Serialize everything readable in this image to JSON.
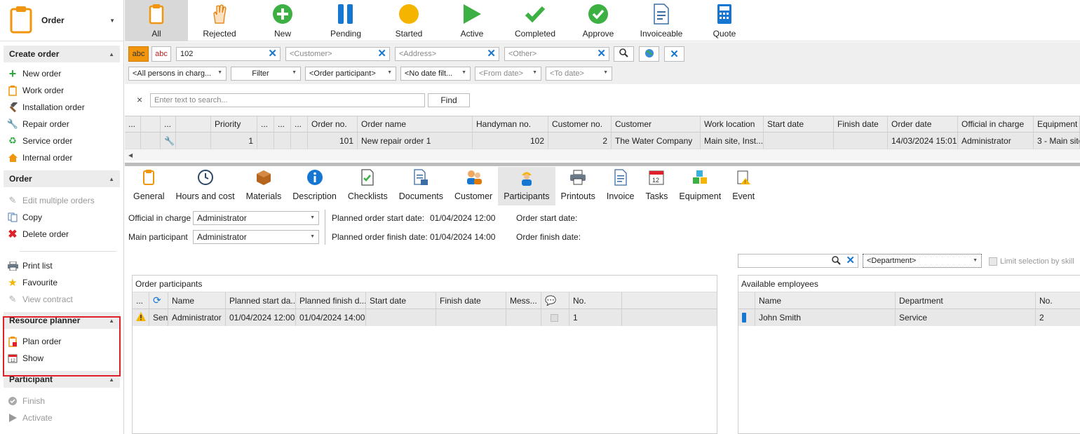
{
  "app": {
    "module_title": "Order"
  },
  "colors": {
    "accent_blue": "#1677d2",
    "orange": "#f0950c",
    "green": "#2eaa3f",
    "red": "#e0202a",
    "highlight_box": "#e0202a"
  },
  "toolbar": [
    {
      "label": "All",
      "icon": "clipboard-icon",
      "active": true
    },
    {
      "label": "Rejected",
      "icon": "hand-icon"
    },
    {
      "label": "New",
      "icon": "plus-icon"
    },
    {
      "label": "Pending",
      "icon": "pause-icon"
    },
    {
      "label": "Started",
      "icon": "circle-icon"
    },
    {
      "label": "Active",
      "icon": "play-icon"
    },
    {
      "label": "Completed",
      "icon": "check-icon"
    },
    {
      "label": "Approve",
      "icon": "approve-icon"
    },
    {
      "label": "Invoiceable",
      "icon": "invoice-icon"
    },
    {
      "label": "Quote",
      "icon": "calculator-icon"
    }
  ],
  "sidebar": {
    "sections": {
      "create_order": {
        "title": "Create order",
        "items": [
          "New order",
          "Work order",
          "Installation order",
          "Repair order",
          "Service order",
          "Internal order"
        ]
      },
      "order": {
        "title": "Order",
        "items": [
          "Edit multiple orders",
          "Copy",
          "Delete order",
          "Print list",
          "Favourite",
          "View contract"
        ]
      },
      "resource_planner": {
        "title": "Resource planner",
        "items": [
          "Plan order",
          "Show"
        ]
      },
      "participant": {
        "title": "Participant",
        "items": [
          "Finish",
          "Activate"
        ]
      }
    }
  },
  "filters": {
    "abc1": "abc",
    "abc2": "abc",
    "order_value": "102",
    "customer_placeholder": "<Customer>",
    "address_placeholder": "<Address>",
    "other_placeholder": "<Other>",
    "persons": "<All persons in charg...",
    "filter": "Filter",
    "participant": "<Order participant>",
    "date_filter": "<No date filt...",
    "from_date": "<From date>",
    "to_date": "<To date>"
  },
  "search": {
    "placeholder": "Enter text to search...",
    "find": "Find",
    "clear": "×"
  },
  "grid": {
    "columns": [
      "...",
      "",
      "...",
      "",
      "Priority",
      "...",
      "...",
      "...",
      "Order no.",
      "Order name",
      "Handyman no.",
      "Customer no.",
      "Customer",
      "Work location",
      "Start date",
      "Finish date",
      "Order date",
      "Official in charge",
      "Equipment"
    ],
    "row": [
      "",
      "",
      "",
      "",
      "1",
      "",
      "",
      "",
      "101",
      "New repair order 1",
      "102",
      "2",
      "The Water Company",
      "Main site, Inst...",
      "",
      "",
      "14/03/2024 15:01",
      "Administrator",
      "3 - Main site"
    ]
  },
  "tabs": [
    {
      "label": "General",
      "icon": "clipboard-icon"
    },
    {
      "label": "Hours and cost",
      "icon": "clock-icon"
    },
    {
      "label": "Materials",
      "icon": "box-icon"
    },
    {
      "label": "Description",
      "icon": "info-icon"
    },
    {
      "label": "Checklists",
      "icon": "checklist-icon"
    },
    {
      "label": "Documents",
      "icon": "documents-icon"
    },
    {
      "label": "Customer",
      "icon": "customer-icon"
    },
    {
      "label": "Participants",
      "icon": "worker-icon",
      "active": true
    },
    {
      "label": "Printouts",
      "icon": "printer-icon"
    },
    {
      "label": "Invoice",
      "icon": "invoice-icon"
    },
    {
      "label": "Tasks",
      "icon": "calendar-icon"
    },
    {
      "label": "Equipment",
      "icon": "cubes-icon"
    },
    {
      "label": "Event",
      "icon": "event-icon"
    }
  ],
  "participants": {
    "official_label": "Official in charge",
    "official_value": "Administrator",
    "main_label": "Main participant",
    "main_value": "Administrator",
    "planned_start_label": "Planned order start date:",
    "planned_start_value": "01/04/2024 12:00",
    "planned_finish_label": "Planned order finish date:",
    "planned_finish_value": "01/04/2024 14:00",
    "order_start_label": "Order start date:",
    "order_finish_label": "Order finish date:",
    "department_placeholder": "<Department>",
    "limit_label": "Limit selection by skill",
    "order_participants": {
      "title": "Order participants",
      "columns": [
        "...",
        "",
        "Name",
        "Planned start da...",
        "Planned finish d...",
        "Start date",
        "Finish date",
        "Mess...",
        "",
        "No."
      ],
      "row": [
        "",
        "Send",
        "Administrator",
        "01/04/2024 12:00",
        "01/04/2024 14:00",
        "",
        "",
        "",
        "",
        "1"
      ]
    },
    "available": {
      "title": "Available employees",
      "columns": [
        "",
        "Name",
        "Department",
        "No."
      ],
      "row": [
        "",
        "John Smith",
        "Service",
        "2"
      ]
    }
  }
}
